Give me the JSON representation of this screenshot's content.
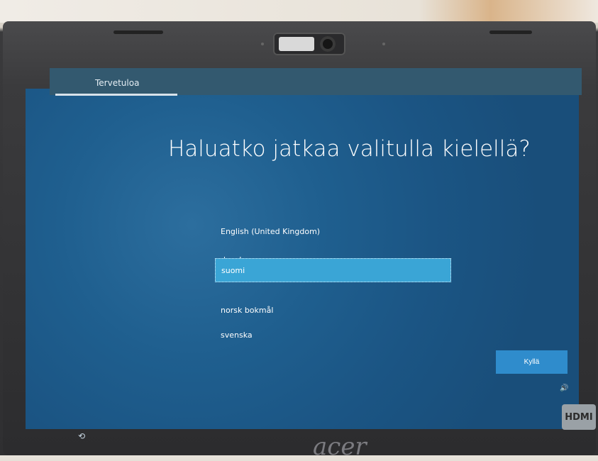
{
  "window": {
    "tab_label": "Tervetuloa"
  },
  "main": {
    "title": "Haluatko jatkaa valitulla kielellä?",
    "languages": [
      {
        "label": "English (United Kingdom)",
        "selected": false
      },
      {
        "label": "dansk",
        "selected": false
      },
      {
        "label": "suomi",
        "selected": true
      },
      {
        "label": "norsk bokmål",
        "selected": false
      },
      {
        "label": "svenska",
        "selected": false
      }
    ],
    "ok_button_label": "Kyllä"
  },
  "icons": {
    "volume": "volume-icon",
    "accessibility": "accessibility-icon"
  },
  "hardware": {
    "hdmi_label": "HDMI",
    "brand_label": "acer"
  },
  "colors": {
    "selected_bg": "#3aa5d6",
    "button_bg": "#2f8ccc",
    "screen_bg": "#1f5f8f"
  }
}
